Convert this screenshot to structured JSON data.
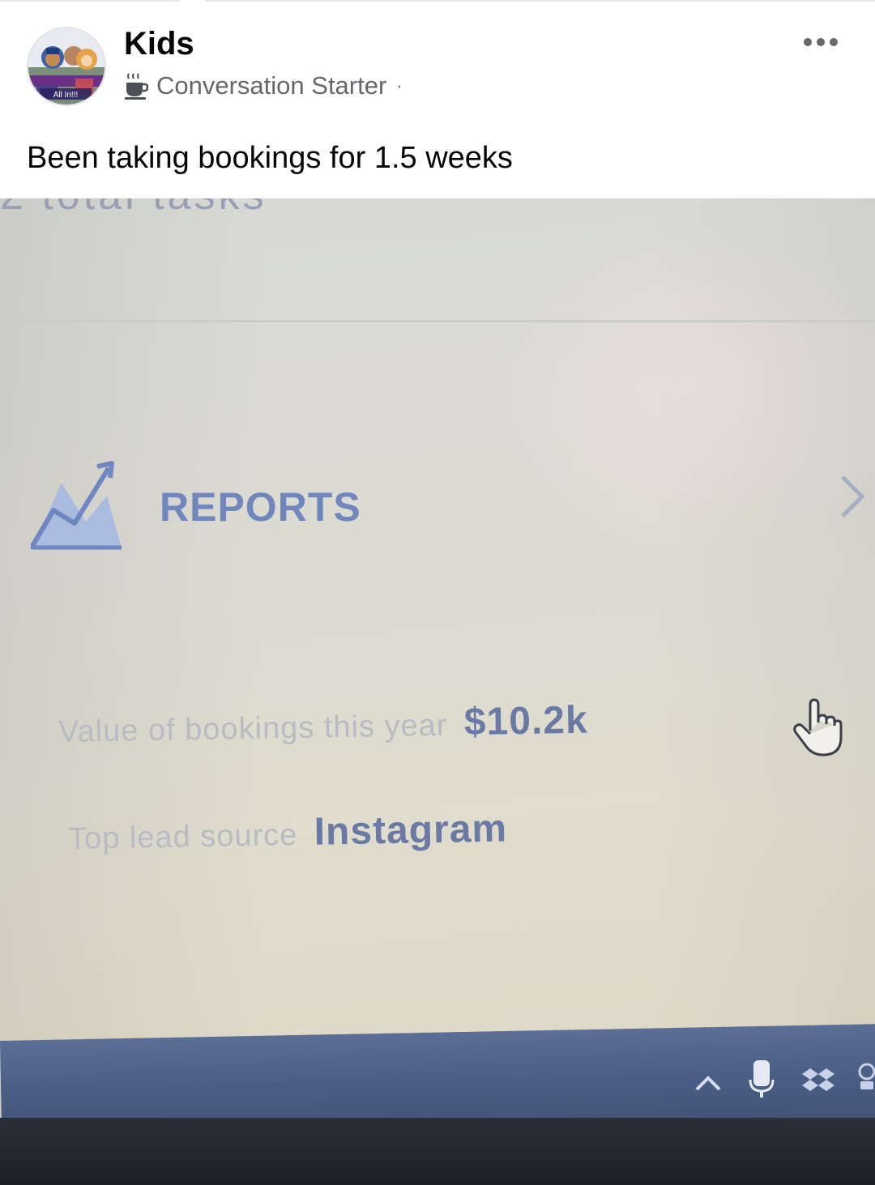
{
  "post": {
    "group_name": "Kids",
    "badge_label": "Conversation Starter",
    "badge_separator": "·",
    "body_text": "Been taking bookings for 1.5 weeks",
    "avatar_caption": "All In!!!",
    "badge_icon": "coffee-cup-icon",
    "more_icon": "more-options-icon"
  },
  "photo": {
    "cut_off_text": "2 total tasks",
    "reports_label": "REPORTS",
    "reports_icon": "trend-chart-icon",
    "stats": [
      {
        "label": "Value of bookings this year",
        "value": "$10.2k"
      },
      {
        "label": "Top lead source",
        "value": "Instagram"
      }
    ],
    "cursor_icon": "hand-pointer-icon",
    "tray_icons": [
      "chevron-up-icon",
      "microphone-icon",
      "dropbox-icon"
    ]
  },
  "colors": {
    "accent": "#7286be",
    "value_text": "#6b7aa4",
    "taskbar": "#4b5f86"
  }
}
